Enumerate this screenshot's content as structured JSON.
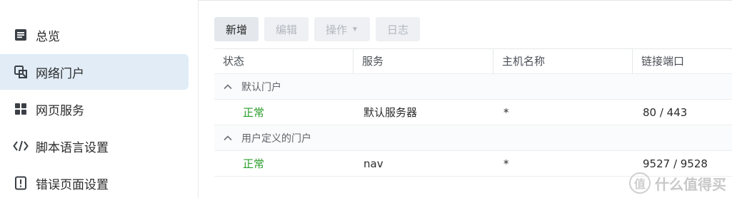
{
  "sidebar": {
    "items": [
      {
        "label": "总览",
        "icon": "overview-icon"
      },
      {
        "label": "网络门户",
        "icon": "portal-icon",
        "active": true
      },
      {
        "label": "网页服务",
        "icon": "web-service-icon"
      },
      {
        "label": "脚本语言设置",
        "icon": "code-icon"
      },
      {
        "label": "错误页面设置",
        "icon": "error-page-icon"
      }
    ]
  },
  "toolbar": {
    "add_label": "新增",
    "edit_label": "编辑",
    "action_label": "操作",
    "log_label": "日志"
  },
  "table": {
    "columns": [
      "状态",
      "服务",
      "主机名称",
      "链接端口"
    ],
    "groups": [
      {
        "label": "默认门户",
        "rows": [
          {
            "status": "正常",
            "service": "默认服务器",
            "host": "*",
            "port": "80 / 443"
          }
        ]
      },
      {
        "label": "用户定义的门户",
        "rows": [
          {
            "status": "正常",
            "service": "nav",
            "host": "*",
            "port": "9527 / 9528"
          }
        ]
      }
    ]
  },
  "watermark": {
    "logo_text": "值",
    "text": "什么值得买"
  },
  "colors": {
    "active_bg": "#e1ecf6",
    "status_ok": "#2a9d2a"
  }
}
